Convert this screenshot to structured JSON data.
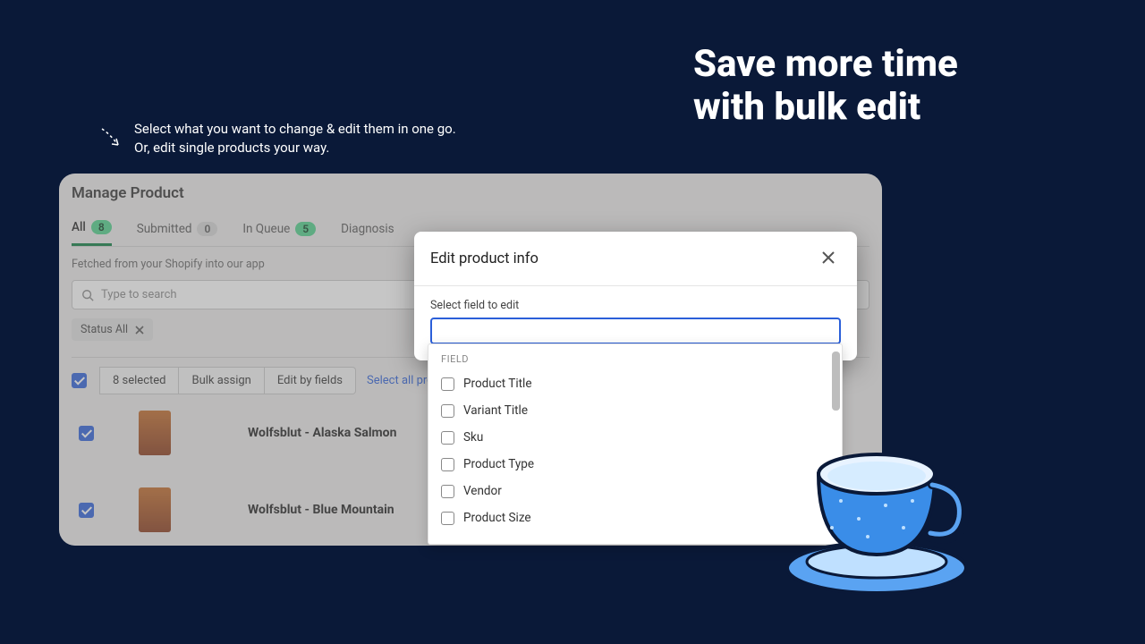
{
  "hero": {
    "line1": "Save more time",
    "line2": "with bulk edit"
  },
  "callout": {
    "line1": "Select what you want to change & edit them in one go.",
    "line2": "Or, edit single products your way."
  },
  "page_title": "Manage Product",
  "tabs": [
    {
      "label": "All",
      "count": "8",
      "active": true
    },
    {
      "label": "Submitted",
      "count": "0",
      "active": false
    },
    {
      "label": "In Queue",
      "count": "5",
      "active": false
    },
    {
      "label": "Diagnosis",
      "count": null,
      "active": false
    }
  ],
  "subtext": "Fetched from your Shopify into our app",
  "search_placeholder": "Type to search",
  "filter_chip": "Status All",
  "toolbar": {
    "selected_label": "8 selected",
    "bulk_assign": "Bulk assign",
    "edit_by_fields": "Edit by fields",
    "select_all": "Select all products"
  },
  "rows": [
    {
      "title": "Wolfsblut - Alaska Salmon"
    },
    {
      "title": "Wolfsblut - Blue Mountain"
    }
  ],
  "modal": {
    "title": "Edit product info",
    "field_label": "Select field to edit",
    "group_header": "FIELD",
    "options": [
      "Product Title",
      "Variant Title",
      "Sku",
      "Product Type",
      "Vendor",
      "Product Size"
    ]
  }
}
